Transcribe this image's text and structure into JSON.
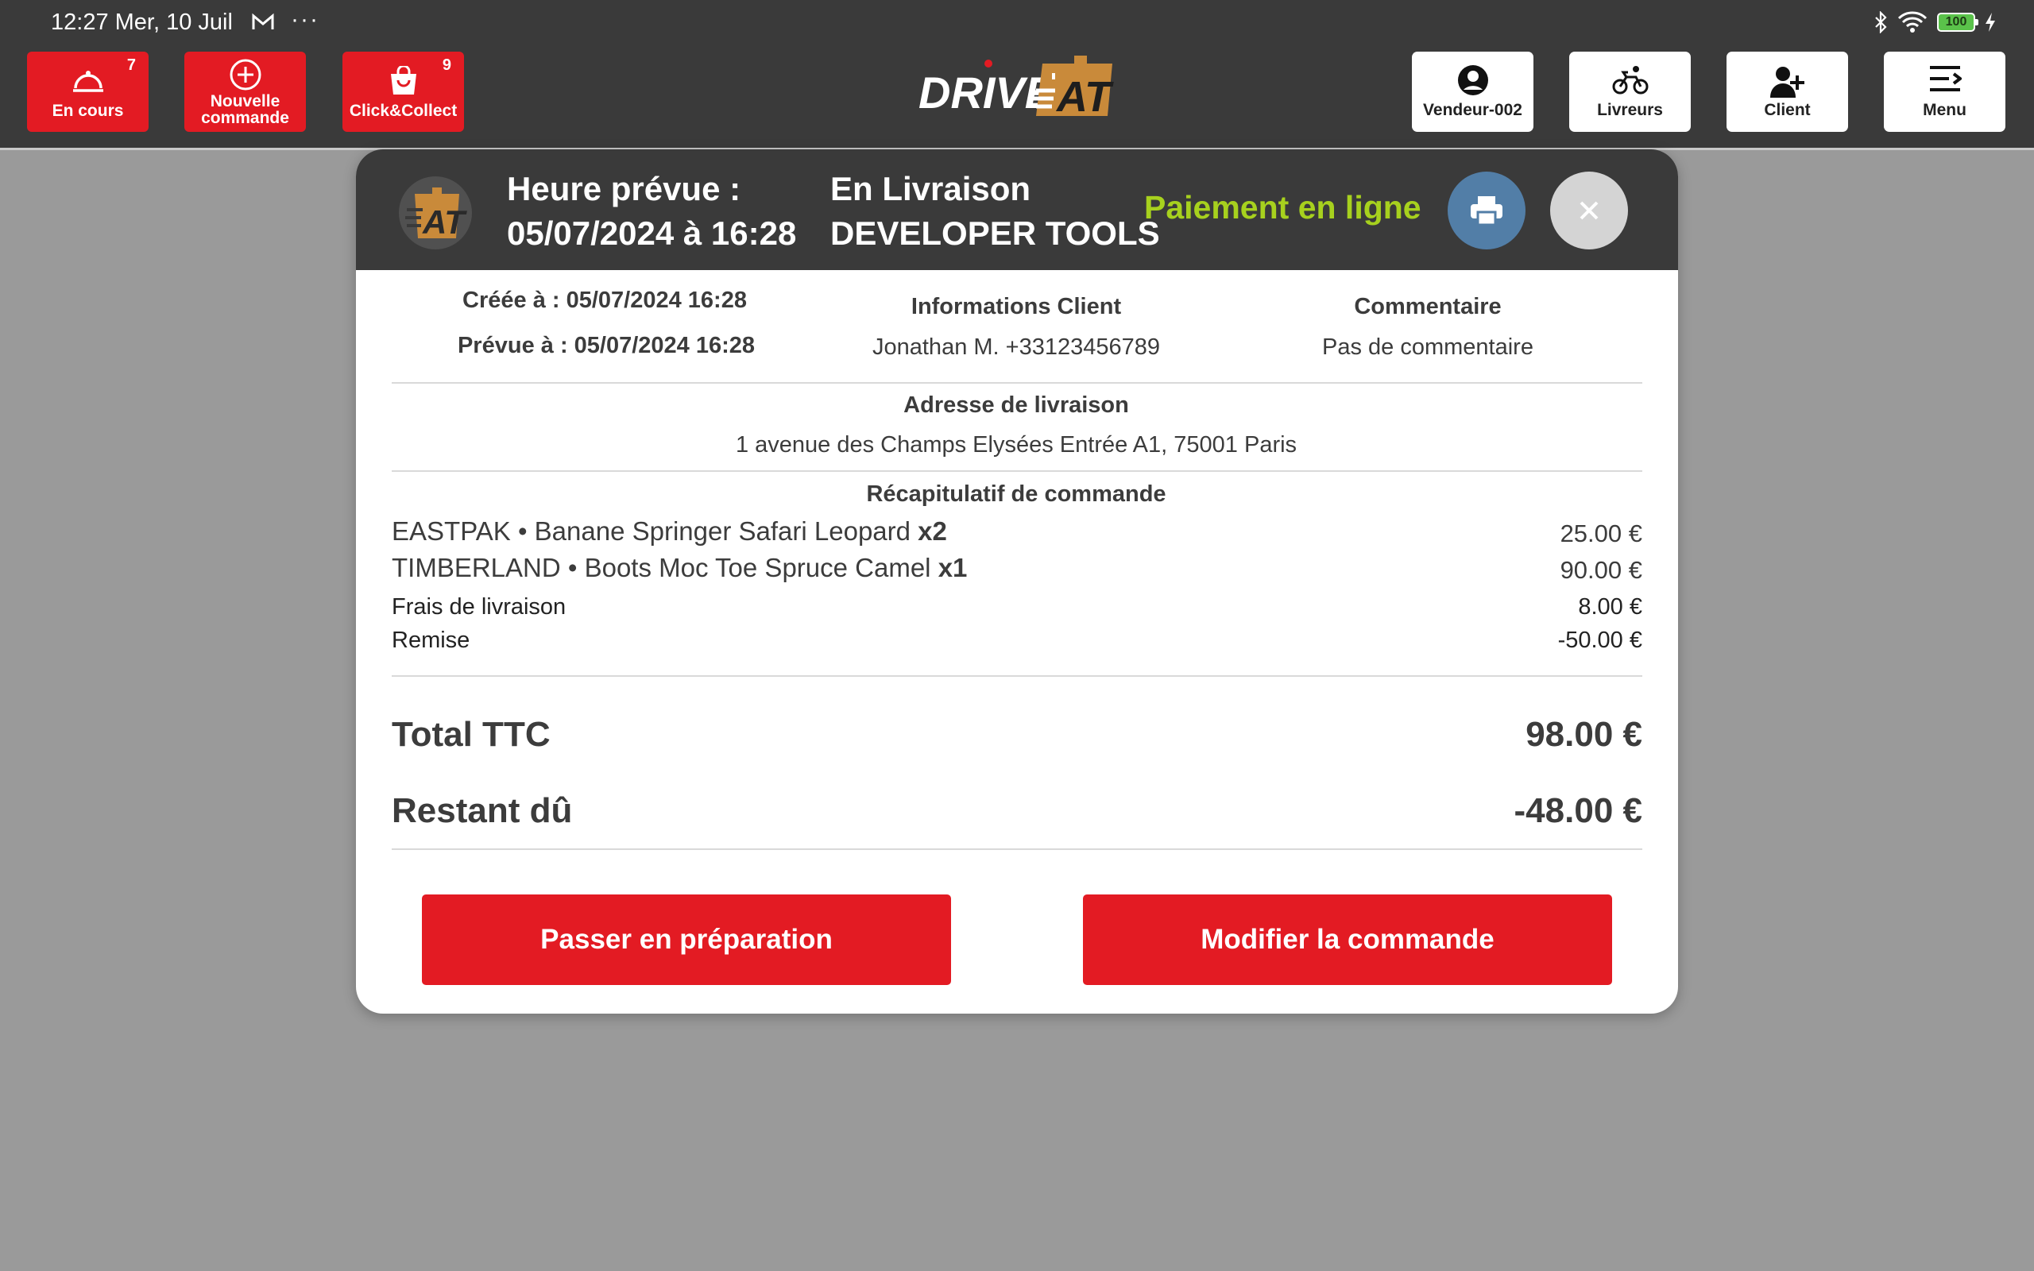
{
  "statusbar": {
    "time": "12:27 Mer, 10 Juil",
    "dots": "···",
    "battery": "100"
  },
  "toolbar": {
    "en_cours": {
      "label": "En cours",
      "badge": "7"
    },
    "nouvelle_commande": {
      "line1": "Nouvelle",
      "line2": "commande"
    },
    "click_collect": {
      "label": "Click&Collect",
      "badge": "9"
    },
    "vendeur": "Vendeur-002",
    "livreurs": "Livreurs",
    "client": "Client",
    "menu": "Menu"
  },
  "logo": {
    "word1": "DRIVE",
    "word2": "AT"
  },
  "order": {
    "header": {
      "heure_label": "Heure prévue :",
      "heure_value": "05/07/2024 à 16:28",
      "status": "En Livraison",
      "store": "DEVELOPER TOOLS",
      "payment": "Paiement en ligne"
    },
    "created": "Créée à : 05/07/2024 16:28",
    "planned": "Prévue à : 05/07/2024 16:28",
    "client_title": "Informations Client",
    "client_value": "Jonathan M. +33123456789",
    "comment_title": "Commentaire",
    "comment_value": "Pas de commentaire",
    "address_title": "Adresse de livraison",
    "address_value": "1 avenue des Champs Elysées Entrée A1, 75001 Paris",
    "recap_title": "Récapitulatif de commande",
    "items": [
      {
        "name": "EASTPAK • Banane Springer Safari Leopard",
        "qty": "x2",
        "price": "25.00 €"
      },
      {
        "name": "TIMBERLAND • Boots Moc Toe Spruce Camel",
        "qty": "x1",
        "price": "90.00 €"
      }
    ],
    "delivery_fee": {
      "label": "Frais de livraison",
      "value": "8.00 €"
    },
    "discount": {
      "label": "Remise",
      "value": "-50.00 €"
    },
    "total": {
      "label": "Total TTC",
      "value": "98.00 €"
    },
    "remaining": {
      "label": "Restant dû",
      "value": "-48.00 €"
    },
    "btn_prepare": "Passer en préparation",
    "btn_modify": "Modifier la commande"
  },
  "colors": {
    "accent_red": "#e31b23",
    "payment_green": "#a7d11e",
    "print_blue": "#527ea7",
    "logo_orange": "#c98a3a"
  }
}
